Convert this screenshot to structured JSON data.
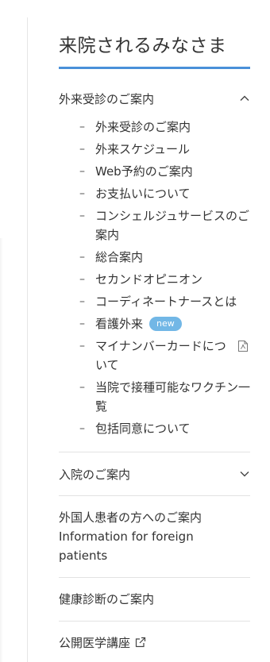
{
  "sidebar": {
    "title": "来院されるみなさま",
    "accent_color": "#4a90d9",
    "sections": [
      {
        "label": "外来受診のご案内",
        "expanded": true,
        "chevron": "chevron-up-icon",
        "items": [
          {
            "label": "外来受診のご案内"
          },
          {
            "label": "外来スケジュール"
          },
          {
            "label": "Web予約のご案内"
          },
          {
            "label": "お支払いについて"
          },
          {
            "label": "コンシェルジュサービスのご案内"
          },
          {
            "label": "総合案内"
          },
          {
            "label": "セカンドオピニオン"
          },
          {
            "label": "コーディネートナースとは"
          },
          {
            "label": "看護外来",
            "badge": "new"
          },
          {
            "label": "マイナンバーカードについて",
            "icon": "pdf-icon"
          },
          {
            "label": "当院で接種可能なワクチン一覧"
          },
          {
            "label": "包括同意について"
          }
        ]
      },
      {
        "label": "入院のご案内",
        "expanded": false,
        "chevron": "chevron-down-icon"
      }
    ],
    "links": {
      "foreign": {
        "line1": "外国人患者の方へのご案内",
        "line2": "Information for foreign",
        "line3": "patients"
      },
      "checkup": "健康診断のご案内",
      "lecture": "公開医学講座",
      "lecture_icon": "external-link-icon"
    },
    "badge_color": "#72b7e6"
  }
}
